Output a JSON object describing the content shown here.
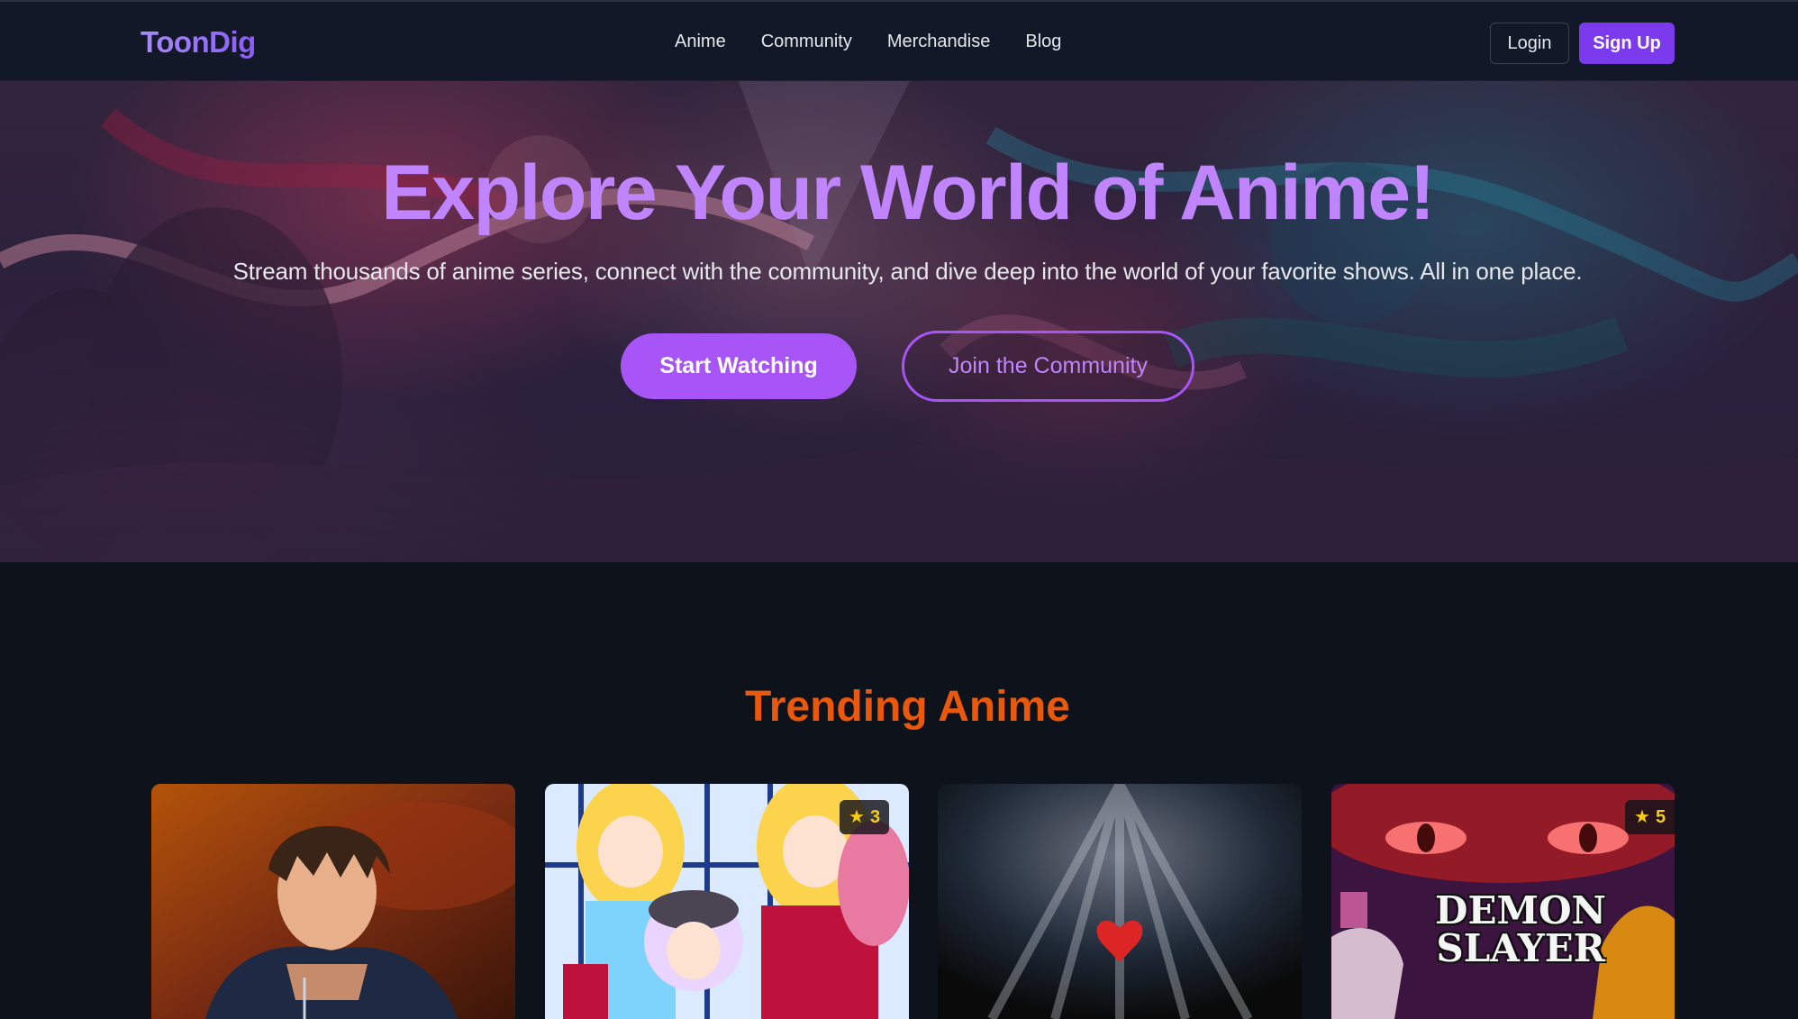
{
  "navbar": {
    "logo": "ToonDig",
    "links": [
      "Anime",
      "Community",
      "Merchandise",
      "Blog"
    ],
    "login_label": "Login",
    "signup_label": "Sign Up"
  },
  "hero": {
    "title": "Explore Your World of Anime!",
    "subtitle": "Stream thousands of anime series, connect with the community, and dive deep into the world of your favorite shows. All in one place.",
    "primary_cta": "Start Watching",
    "secondary_cta": "Join the Community"
  },
  "trending": {
    "title": "Trending Anime",
    "cards": [
      {
        "rating": ""
      },
      {
        "rating": "3"
      },
      {
        "rating": ""
      },
      {
        "rating": "5",
        "cover_text": "DEMON SLAYER"
      }
    ]
  },
  "colors": {
    "accent": "#a855f7",
    "brand": "#7c3aed",
    "trending_title": "#ea580c",
    "rating_star": "#facc15",
    "background": "#0e121b"
  }
}
